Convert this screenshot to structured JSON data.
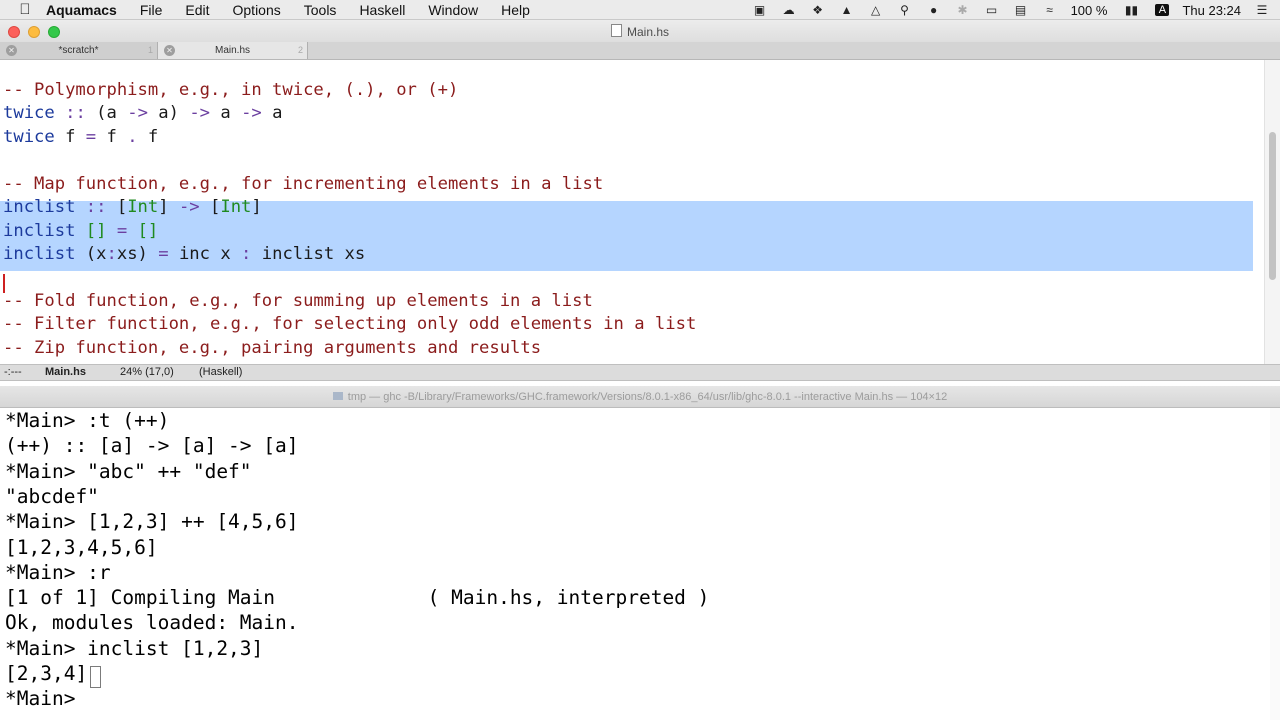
{
  "menubar": {
    "app_name": "Aquamacs",
    "menus": [
      "File",
      "Edit",
      "Options",
      "Tools",
      "Haskell",
      "Window",
      "Help"
    ],
    "battery": "100 %",
    "input_source": "A",
    "clock": "Thu 23:24"
  },
  "window": {
    "title": "Main.hs",
    "tabs": [
      {
        "label": "*scratch*",
        "index": "1"
      },
      {
        "label": "Main.hs",
        "index": "2"
      }
    ]
  },
  "editor": {
    "lines": [
      [
        {
          "t": "-- Polymorphism, e.g., in twice, (.), or (+)",
          "c": "cm"
        }
      ],
      [
        {
          "t": "twice",
          "c": "fn"
        },
        {
          "t": " "
        },
        {
          "t": "::",
          "c": "kw"
        },
        {
          "t": " (a "
        },
        {
          "t": "->",
          "c": "kw"
        },
        {
          "t": " a) "
        },
        {
          "t": "->",
          "c": "kw"
        },
        {
          "t": " a "
        },
        {
          "t": "->",
          "c": "kw"
        },
        {
          "t": " a"
        }
      ],
      [
        {
          "t": "twice",
          "c": "fn"
        },
        {
          "t": " f "
        },
        {
          "t": "=",
          "c": "kw"
        },
        {
          "t": " f "
        },
        {
          "t": ".",
          "c": "kw"
        },
        {
          "t": " f"
        }
      ],
      [
        {
          "t": ""
        }
      ],
      [
        {
          "t": "-- Map function, e.g., for incrementing elements in a list",
          "c": "cm"
        }
      ],
      [
        {
          "t": "inclist",
          "c": "fn"
        },
        {
          "t": " "
        },
        {
          "t": "::",
          "c": "kw"
        },
        {
          "t": " ["
        },
        {
          "t": "Int",
          "c": "ty"
        },
        {
          "t": "] "
        },
        {
          "t": "->",
          "c": "kw"
        },
        {
          "t": " ["
        },
        {
          "t": "Int",
          "c": "ty"
        },
        {
          "t": "]"
        }
      ],
      [
        {
          "t": "inclist",
          "c": "fn"
        },
        {
          "t": " "
        },
        {
          "t": "[]",
          "c": "ty"
        },
        {
          "t": " "
        },
        {
          "t": "=",
          "c": "kw"
        },
        {
          "t": " "
        },
        {
          "t": "[]",
          "c": "ty"
        }
      ],
      [
        {
          "t": "inclist",
          "c": "fn"
        },
        {
          "t": " (x"
        },
        {
          "t": ":",
          "c": "kw"
        },
        {
          "t": "xs) "
        },
        {
          "t": "=",
          "c": "kw"
        },
        {
          "t": " inc x "
        },
        {
          "t": ":",
          "c": "kw"
        },
        {
          "t": " inclist xs"
        }
      ],
      [
        {
          "t": ""
        }
      ],
      [
        {
          "t": "-- Fold function, e.g., for summing up elements in a list",
          "c": "cm"
        }
      ],
      [
        {
          "t": "-- Filter function, e.g., for selecting only odd elements in a list",
          "c": "cm"
        }
      ],
      [
        {
          "t": "-- Zip function, e.g., pairing arguments and results",
          "c": "cm"
        }
      ]
    ]
  },
  "modeline": {
    "status": "-:---",
    "buffer": "Main.hs",
    "position": "24% (17,0)",
    "mode": "(Haskell)"
  },
  "terminal": {
    "title": "tmp — ghc -B/Library/Frameworks/GHC.framework/Versions/8.0.1-x86_64/usr/lib/ghc-8.0.1 --interactive Main.hs — 104×12",
    "lines": [
      "*Main> :t (++)",
      "(++) :: [a] -> [a] -> [a]",
      "*Main> \"abc\" ++ \"def\"",
      "\"abcdef\"",
      "*Main> [1,2,3] ++ [4,5,6]",
      "[1,2,3,4,5,6]",
      "*Main> :r",
      "[1 of 1] Compiling Main             ( Main.hs, interpreted )",
      "Ok, modules loaded: Main.",
      "*Main> inclist [1,2,3]",
      "[2,3,4]",
      "*Main> "
    ]
  }
}
